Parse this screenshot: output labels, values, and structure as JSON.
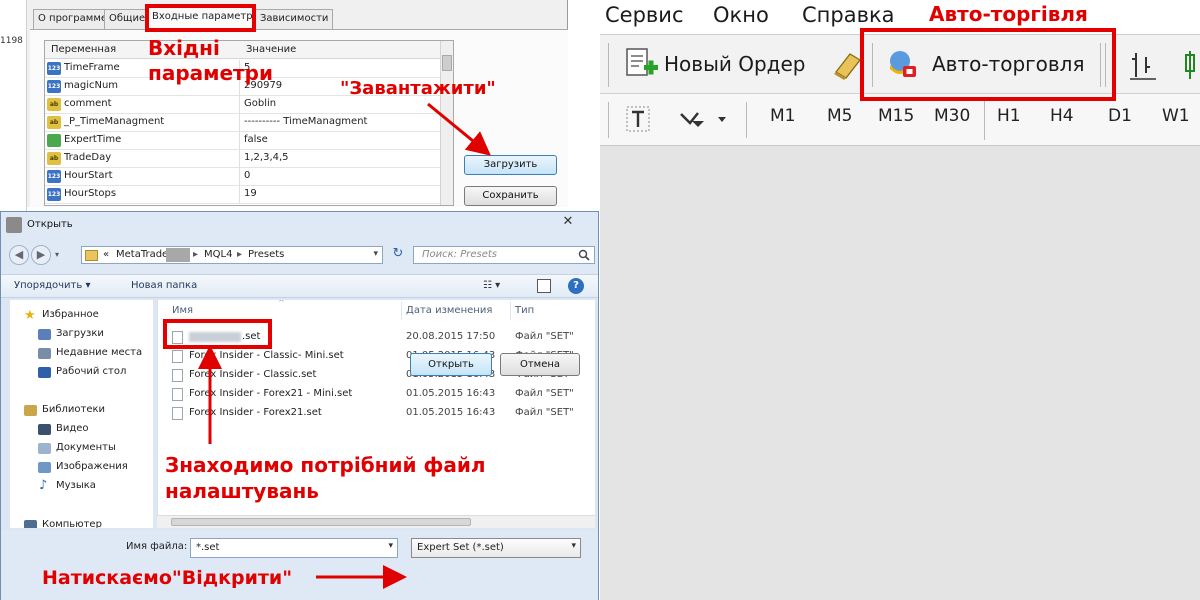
{
  "props": {
    "tabs": [
      "О программе",
      "Общие",
      "Входные параметры",
      "Зависимости"
    ],
    "left_strip_text": "1198",
    "grid_headers": {
      "name": "Переменная",
      "value": "Значение"
    },
    "rows": [
      {
        "name": "TimeFrame",
        "value": "5",
        "kind": "num",
        "kind_label": "123"
      },
      {
        "name": "magicNum",
        "value": "290979",
        "kind": "num",
        "kind_label": "123"
      },
      {
        "name": "comment",
        "value": "Goblin",
        "kind": "str",
        "kind_label": "ab"
      },
      {
        "name": "_P_TimeManagment",
        "value": "---------- TimeManagment",
        "kind": "str",
        "kind_label": "ab"
      },
      {
        "name": "ExpertTime",
        "value": "false",
        "kind": "bool",
        "kind_label": ""
      },
      {
        "name": "TradeDay",
        "value": "1,2,3,4,5",
        "kind": "str",
        "kind_label": "ab"
      },
      {
        "name": "HourStart",
        "value": "0",
        "kind": "num",
        "kind_label": "123"
      },
      {
        "name": "HourStops",
        "value": "19",
        "kind": "num",
        "kind_label": "123"
      }
    ],
    "load_label": "Загрузить",
    "save_label": "Сохранить"
  },
  "dialog": {
    "title": "Открыть",
    "path": [
      "MetaTrader",
      "MQL4",
      "Presets"
    ],
    "path_prefix": "«",
    "search_placeholder": "Поиск: Presets",
    "organize_label": "Упорядочить ▾",
    "new_folder_label": "Новая папка",
    "nav": {
      "favorites_label": "Избранное",
      "downloads_label": "Загрузки",
      "recent_label": "Недавние места",
      "desktop_label": "Рабочий стол",
      "libraries_label": "Библиотеки",
      "video_label": "Видео",
      "documents_label": "Документы",
      "images_label": "Изображения",
      "music_label": "Музыка",
      "computer_label": "Компьютер"
    },
    "columns": {
      "name": "Имя",
      "date": "Дата изменения",
      "type": "Тип"
    },
    "files": [
      {
        "name": ".set",
        "date": "20.08.2015 17:50",
        "type": "Файл \"SET\""
      },
      {
        "name": "Forex Insider - Classic- Mini.set",
        "date": "01.05.2015 16:43",
        "type": "Файл \"SET\""
      },
      {
        "name": "Forex Insider - Classic.set",
        "date": "01.05.2015 16:43",
        "type": "Файл \"SET\""
      },
      {
        "name": "Forex Insider - Forex21 - Mini.set",
        "date": "01.05.2015 16:43",
        "type": "Файл \"SET\""
      },
      {
        "name": "Forex Insider - Forex21.set",
        "date": "01.05.2015 16:43",
        "type": "Файл \"SET\""
      }
    ],
    "filename_label": "Имя файла:",
    "filename_value": "*.set",
    "filetype_value": "Expert Set (*.set)",
    "open_label": "Открыть",
    "cancel_label": "Отмена"
  },
  "mt4": {
    "menu": [
      "Сервис",
      "Окно",
      "Справка"
    ],
    "new_order_label": "Новый Ордер",
    "autotrading_label": "Авто-торговля",
    "timeframes": [
      "M1",
      "M5",
      "M15",
      "M30",
      "H1",
      "H4",
      "D1",
      "W1"
    ]
  },
  "annotations": {
    "input_params": "Вхідні\nпараметри",
    "load": "\"Завантажити\"",
    "autotrading": "Авто-торгівля",
    "find_file": "Знаходимо потрібний файл\nналаштувань",
    "press_open": "Натискаємо\"Відкрити\""
  },
  "colors": {
    "annotation": "#e00000",
    "dialog_bg": "#dce7f3",
    "accent_button": "#c6e4f7"
  }
}
